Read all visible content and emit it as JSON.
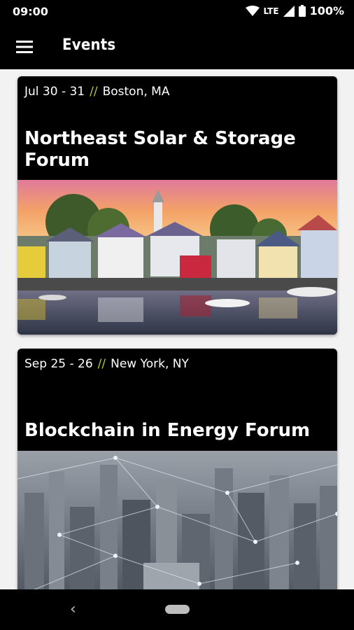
{
  "status_bar": {
    "time": "09:00",
    "network": "LTE",
    "battery": "100%"
  },
  "app_bar": {
    "title": "Events",
    "menu_icon": "hamburger-menu-icon"
  },
  "events": [
    {
      "dates": "Jul 30 - 31",
      "separator": "//",
      "location": "Boston, MA",
      "title": "Northeast Solar & Storage Forum"
    },
    {
      "dates": "Sep 25 - 26",
      "separator": "//",
      "location": "New York, NY",
      "title": "Blockchain in Energy Forum"
    }
  ],
  "colors": {
    "accent": "#b3c92f",
    "bar_background": "#000000",
    "page_background": "#f2f2f2"
  },
  "nav_bar": {
    "back_icon": "back-chevron-icon",
    "home_icon": "home-pill-icon"
  }
}
